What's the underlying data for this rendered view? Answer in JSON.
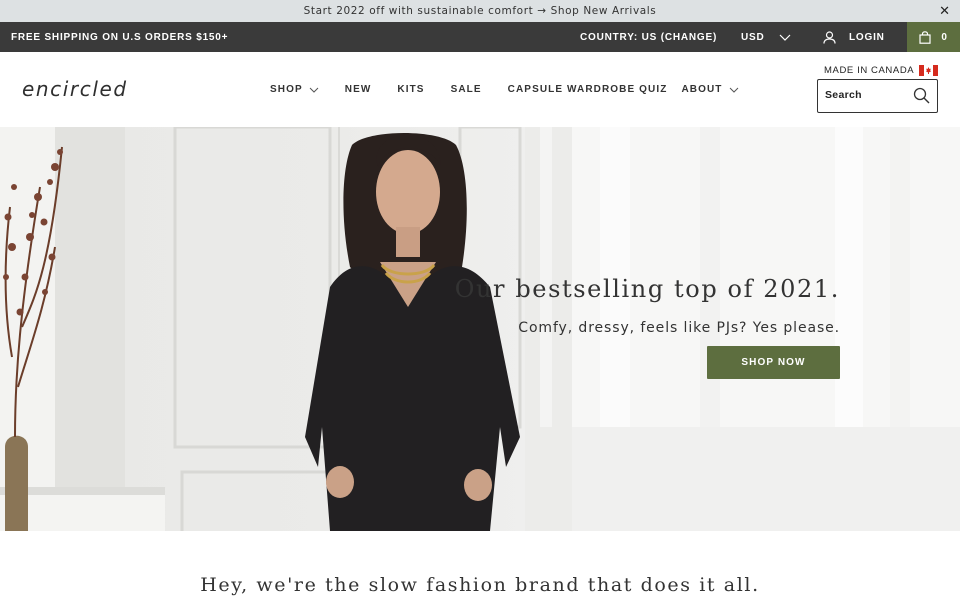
{
  "announcement": {
    "text": "Start 2022 off with sustainable comfort → Shop New Arrivals",
    "close": "✕"
  },
  "utility": {
    "shipping": "FREE SHIPPING ON U.S ORDERS $150+",
    "country": "COUNTRY: US (CHANGE)",
    "currency": "USD",
    "login": "LOGIN",
    "cart_count": "0"
  },
  "header": {
    "logo": "encircled",
    "nav": [
      "SHOP",
      "NEW",
      "KITS",
      "SALE",
      "CAPSULE WARDROBE QUIZ",
      "ABOUT"
    ],
    "made_in": "MADE IN CANADA",
    "search_placeholder": "Search"
  },
  "hero": {
    "title": "Our bestselling top of 2021.",
    "subtitle": "Comfy, dressy, feels like PJs? Yes please.",
    "cta": "SHOP NOW"
  },
  "tagline": "Hey, we're the slow fashion brand that does it all.",
  "colors": {
    "accent": "#5d6e3f",
    "utility_bar": "#3a3a3a",
    "announcement_bar": "#dde1e3"
  },
  "icons": {
    "close": "close-icon",
    "currency_dropdown": "chevron-down-icon",
    "login": "user-icon",
    "cart": "shopping-bag-icon",
    "search": "search-icon",
    "flag": "canada-flag-icon"
  }
}
